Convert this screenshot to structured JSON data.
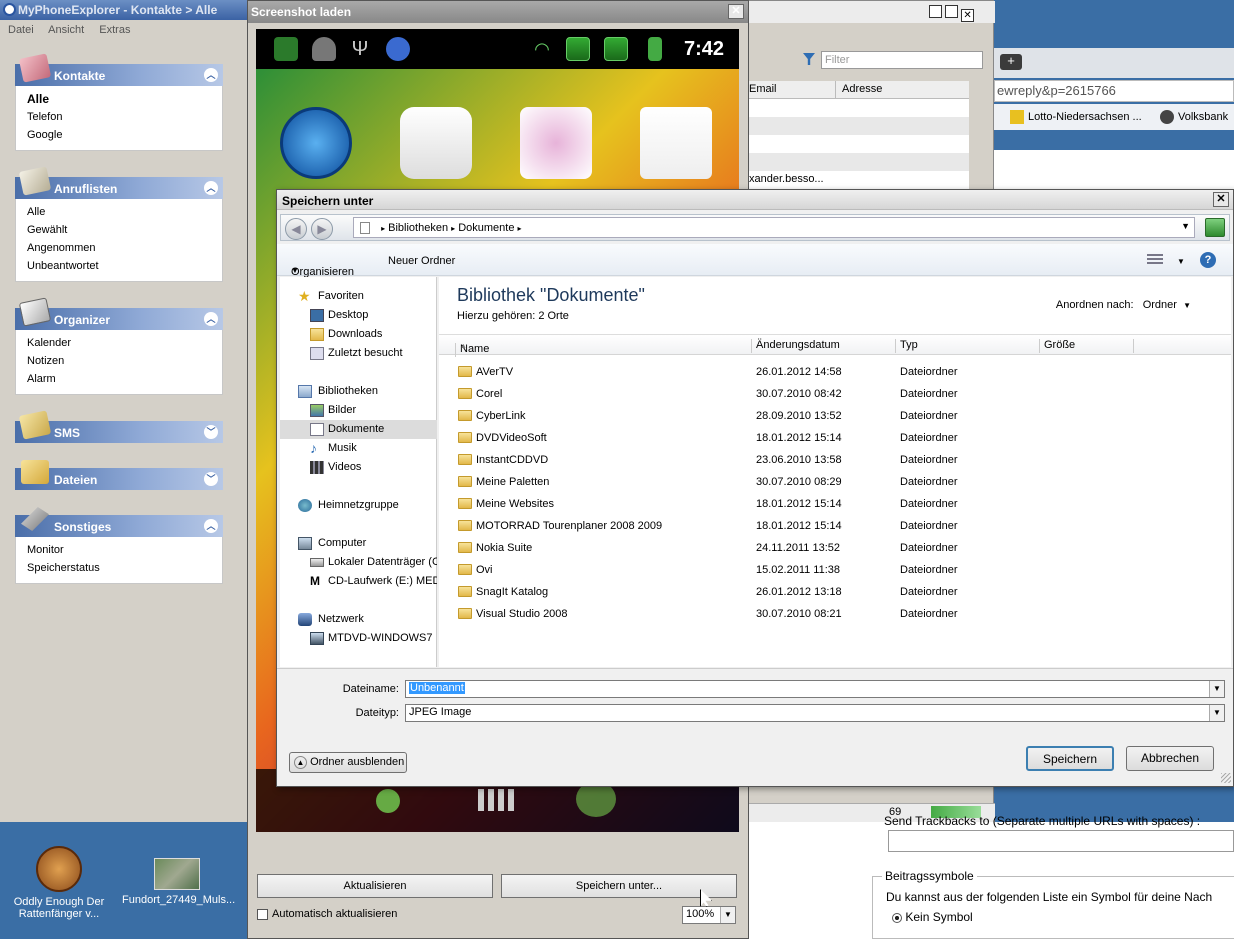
{
  "mpe": {
    "title": "MyPhoneExplorer -  Kontakte > Alle",
    "menu": [
      "Datei",
      "Ansicht",
      "Extras"
    ],
    "groups": [
      {
        "title": "Kontakte",
        "items": [
          "Alle",
          "Telefon",
          "Google"
        ]
      },
      {
        "title": "Anruflisten",
        "items": [
          "Alle",
          "Gewählt",
          "Angenommen",
          "Unbeantwortet"
        ]
      },
      {
        "title": "Organizer",
        "items": [
          "Kalender",
          "Notizen",
          "Alarm"
        ]
      },
      {
        "title": "SMS",
        "items": []
      },
      {
        "title": "Dateien",
        "items": []
      },
      {
        "title": "Sonstiges",
        "items": [
          "Monitor",
          "Speicherstatus"
        ]
      }
    ]
  },
  "desktop": {
    "icons": [
      {
        "label": "Oddly Enough Der Rattenfänger v..."
      },
      {
        "label": "Fundort_27449_Muls..."
      }
    ]
  },
  "contacts": {
    "filter_placeholder": "Filter",
    "col_email": "Email",
    "col_address": "Adresse",
    "row_email": "xander.besso...",
    "status_count": "69"
  },
  "browser": {
    "url": "ewreply&p=2615766",
    "bookmark1": "Lotto-Niedersachsen ...",
    "bookmark2": "Volksbank"
  },
  "forum": {
    "urls_label": "Send Trackbacks to (Separate multiple URLs with spaces) :",
    "beitrag_legend": "Beitragssymbole",
    "beitrag_text": "Du kannst aus der folgenden Liste ein Symbol für deine Nach",
    "kein_symbol": "Kein Symbol"
  },
  "ssl": {
    "title": "Screenshot laden",
    "time": "7:42",
    "refresh_btn": "Aktualisieren",
    "saveas_btn": "Speichern unter...",
    "auto_label": "Automatisch aktualisieren",
    "zoom": "100%"
  },
  "dialog": {
    "title": "Speichern unter",
    "breadcrumb": [
      "Bibliotheken",
      "Dokumente"
    ],
    "organize": "Organisieren",
    "new_folder": "Neuer Ordner",
    "nav": {
      "favorites": "Favoriten",
      "fav_items": [
        "Desktop",
        "Downloads",
        "Zuletzt besucht"
      ],
      "libraries": "Bibliotheken",
      "lib_items": [
        "Bilder",
        "Dokumente",
        "Musik",
        "Videos"
      ],
      "homegroup": "Heimnetzgruppe",
      "computer": "Computer",
      "comp_items": [
        "Lokaler Datenträger (C",
        "CD-Laufwerk (E:) MED"
      ],
      "network": "Netzwerk",
      "net_items": [
        "MTDVD-WINDOWS7"
      ]
    },
    "library_title": "Bibliothek \"Dokumente\"",
    "library_sub": "Hierzu gehören:  2 Orte",
    "arrange_label": "Anordnen nach:",
    "arrange_value": "Ordner",
    "columns": [
      "Name",
      "Änderungsdatum",
      "Typ",
      "Größe"
    ],
    "files": [
      {
        "name": "AVerTV",
        "date": "26.01.2012 14:58",
        "type": "Dateiordner"
      },
      {
        "name": "Corel",
        "date": "30.07.2010 08:42",
        "type": "Dateiordner"
      },
      {
        "name": "CyberLink",
        "date": "28.09.2010 13:52",
        "type": "Dateiordner"
      },
      {
        "name": "DVDVideoSoft",
        "date": "18.01.2012 15:14",
        "type": "Dateiordner"
      },
      {
        "name": "InstantCDDVD",
        "date": "23.06.2010 13:58",
        "type": "Dateiordner"
      },
      {
        "name": "Meine Paletten",
        "date": "30.07.2010 08:29",
        "type": "Dateiordner"
      },
      {
        "name": "Meine Websites",
        "date": "18.01.2012 15:14",
        "type": "Dateiordner"
      },
      {
        "name": "MOTORRAD Tourenplaner 2008 2009",
        "date": "18.01.2012 15:14",
        "type": "Dateiordner"
      },
      {
        "name": "Nokia Suite",
        "date": "24.11.2011 13:52",
        "type": "Dateiordner"
      },
      {
        "name": "Ovi",
        "date": "15.02.2011 11:38",
        "type": "Dateiordner"
      },
      {
        "name": "SnagIt Katalog",
        "date": "26.01.2012 13:18",
        "type": "Dateiordner"
      },
      {
        "name": "Visual Studio 2008",
        "date": "30.07.2010 08:21",
        "type": "Dateiordner"
      }
    ],
    "filename_label": "Dateiname:",
    "filename_value": "Unbenannt",
    "filetype_label": "Dateityp:",
    "filetype_value": "JPEG Image",
    "hide_folders": "Ordner ausblenden",
    "save": "Speichern",
    "cancel": "Abbrechen"
  }
}
